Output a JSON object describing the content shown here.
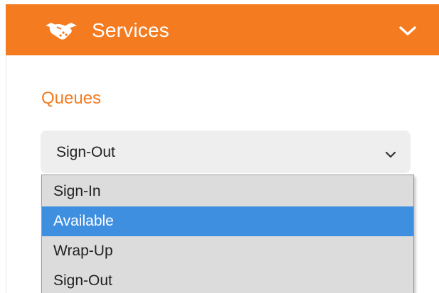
{
  "header": {
    "title": "Services",
    "icon": "handshake-icon",
    "toggle_icon": "chevron-down-icon",
    "background_color": "#f47b20"
  },
  "queues": {
    "title": "Queues",
    "title_color": "#f47b20",
    "select": {
      "selected_value": "Sign-Out",
      "chevron_icon": "chevron-down-icon"
    },
    "options": [
      {
        "label": "Sign-In",
        "highlighted": false
      },
      {
        "label": "Available",
        "highlighted": true
      },
      {
        "label": "Wrap-Up",
        "highlighted": false
      },
      {
        "label": "Sign-Out",
        "highlighted": false
      }
    ],
    "highlight_color": "#3f8fe0"
  }
}
